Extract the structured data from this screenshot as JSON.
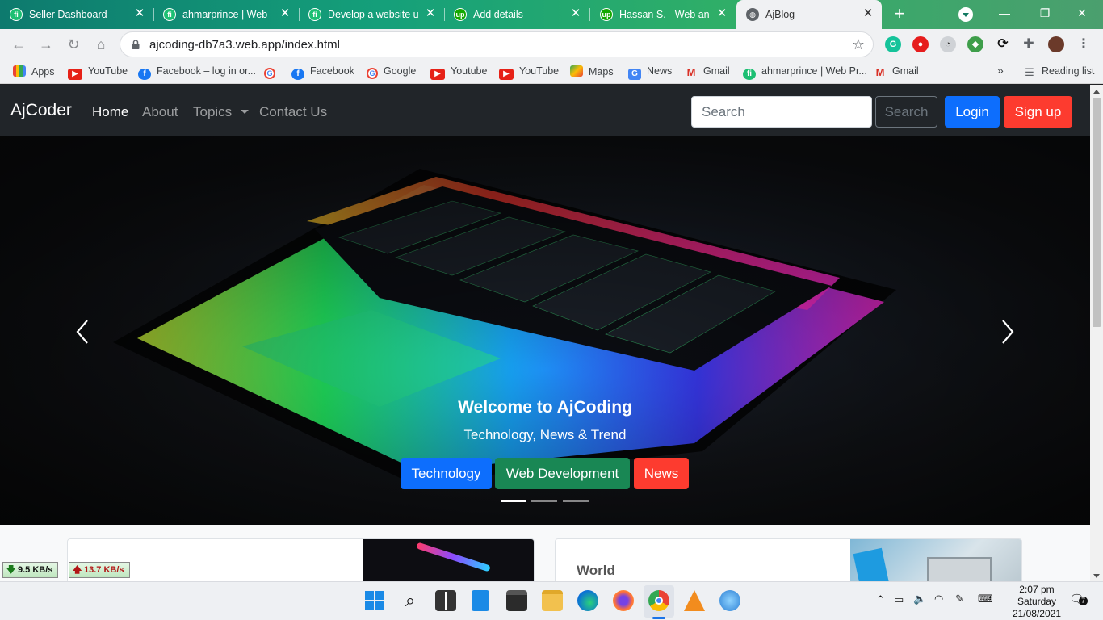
{
  "browser": {
    "tabs": [
      {
        "title": "Seller Dashboard",
        "icon": "fiverr-icon",
        "active": false
      },
      {
        "title": "ahmarprince | Web Pr",
        "icon": "fiverr-icon",
        "active": false
      },
      {
        "title": "Develop a website usi",
        "icon": "fiverr-icon",
        "active": false
      },
      {
        "title": "Add details",
        "icon": "upwork-icon",
        "active": false
      },
      {
        "title": "Hassan S. - Web and F",
        "icon": "upwork-icon",
        "active": false
      },
      {
        "title": "AjBlog",
        "icon": "globe-icon",
        "active": true
      }
    ],
    "new_tab_label": "+",
    "url": "ajcoding-db7a3.web.app/index.html",
    "bookmarks": [
      {
        "label": "Apps",
        "icon": "apps-icon"
      },
      {
        "label": "YouTube",
        "icon": "youtube-icon"
      },
      {
        "label": "Facebook – log in or...",
        "icon": "facebook-icon"
      },
      {
        "label": "",
        "icon": "google-icon"
      },
      {
        "label": "Facebook",
        "icon": "facebook-icon"
      },
      {
        "label": "Google",
        "icon": "google-icon"
      },
      {
        "label": "Youtube",
        "icon": "youtube-icon"
      },
      {
        "label": "YouTube",
        "icon": "youtube-icon"
      },
      {
        "label": "Maps",
        "icon": "maps-icon"
      },
      {
        "label": "News",
        "icon": "news-icon"
      },
      {
        "label": "Gmail",
        "icon": "gmail-icon"
      },
      {
        "label": "ahmarprince | Web Pr...",
        "icon": "fiverr-icon"
      },
      {
        "label": "Gmail",
        "icon": "gmail-icon"
      }
    ],
    "bookmarks_overflow": "»",
    "reading_list": "Reading list"
  },
  "page": {
    "brand": "AjCoder",
    "nav": [
      {
        "label": "Home",
        "active": true
      },
      {
        "label": "About",
        "active": false
      },
      {
        "label": "Topics",
        "active": false,
        "dropdown": true
      },
      {
        "label": "Contact Us",
        "active": false
      }
    ],
    "search_placeholder": "Search",
    "search_button": "Search",
    "login": "Login",
    "signup": "Sign up",
    "carousel": {
      "title": "Welcome to AjCoding",
      "subtitle": "Technology, News & Trend",
      "buttons": [
        {
          "label": "Technology",
          "color": "#0d6efd"
        },
        {
          "label": "Web Development",
          "color": "#198754"
        },
        {
          "label": "News",
          "color": "#fd3b2f"
        }
      ],
      "slide_count": 3,
      "active_slide": 0
    },
    "cards": [
      {
        "title": ""
      },
      {
        "title": "World"
      }
    ]
  },
  "system": {
    "download_speed": "9.5 KB/s",
    "upload_speed": "13.7 KB/s",
    "time": "2:07 pm",
    "day": "Saturday",
    "date": "21/08/2021",
    "notification_count": "7"
  },
  "colors": {
    "primary": "#0d6efd",
    "success": "#198754",
    "danger": "#fd3b2f",
    "navbar": "#212529"
  }
}
